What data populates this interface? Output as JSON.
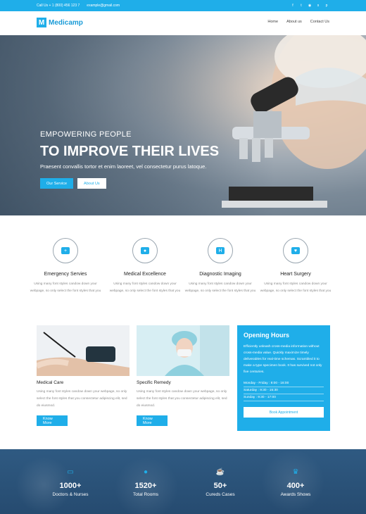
{
  "topbar": {
    "phone": "Call Us + 1 (800) 456 123 7",
    "email": "example@gmail.com",
    "social_icons": [
      "facebook-icon",
      "twitter-icon",
      "instagram-icon",
      "skype-icon",
      "pinterest-icon"
    ]
  },
  "header": {
    "logo_letter": "M",
    "logo_text": "Medicamp",
    "nav": [
      "Home",
      "About us",
      "Contact Us"
    ]
  },
  "hero": {
    "eyebrow": "EMPOWERING PEOPLE",
    "title": "TO IMPROVE THEIR LIVES",
    "subtitle": "Praesent convallis tortor et enim laoreet, vel consectetur purus latoque.",
    "primary_button": "Our Service",
    "secondary_button": "About Us"
  },
  "services": [
    {
      "title": "Emergency Servies",
      "icon": "ambulance-icon",
      "text": "Using many font styles candow down your webpage, so only select the font styles that you"
    },
    {
      "title": "Medical Excellence",
      "icon": "doctor-icon",
      "text": "Using many font styles candow down your webpage, so only select the font styles that you"
    },
    {
      "title": "Diagnostic Imaging",
      "icon": "hospital-icon",
      "text": "Using many font styles candow down your webpage, so only select the font styles that you"
    },
    {
      "title": "Heart Surgery",
      "icon": "heartbeat-icon",
      "text": "Using many font styles candow down your webpage, so only select the font styles that you"
    }
  ],
  "features": [
    {
      "title": "Medical Care",
      "text": "Using many font styles candow down your webpage, so only select the font styles that you consectetur adipiscing elit, sed do eiusmod.",
      "button": "Know More"
    },
    {
      "title": "Specific Remedy",
      "text": "Using many font styles candow down your webpage, so only select the font styles that you consectetur adipiscing elit, sed do eiusmod.",
      "button": "Know More"
    }
  ],
  "hours": {
    "title": "Opening Hours",
    "text": "Efficiently unleash cross-media information without cross-media value. Quickly maximize timely deliverables for real-time schemas. Scrambled it to make a type specimen book. It has survived not only five centuries.",
    "rows": [
      "Monday - Friday : 8:00 - 16:00",
      "Saturday : 9:30 - 15:30",
      "Sunday : 9:30 - 17:00"
    ],
    "button": "Book Appointment"
  },
  "stats": [
    {
      "num": "1000+",
      "label": "Doctors & Nurses",
      "icon": "monitor-icon"
    },
    {
      "num": "1520+",
      "label": "Total Rooms",
      "icon": "people-icon"
    },
    {
      "num": "50+",
      "label": "Cureds Cases",
      "icon": "coffee-cup-icon"
    },
    {
      "num": "400+",
      "label": "Awards Shows",
      "icon": "trophy-icon"
    }
  ],
  "colors": {
    "accent": "#1faee9",
    "stats_bg": "#2f5a82"
  }
}
